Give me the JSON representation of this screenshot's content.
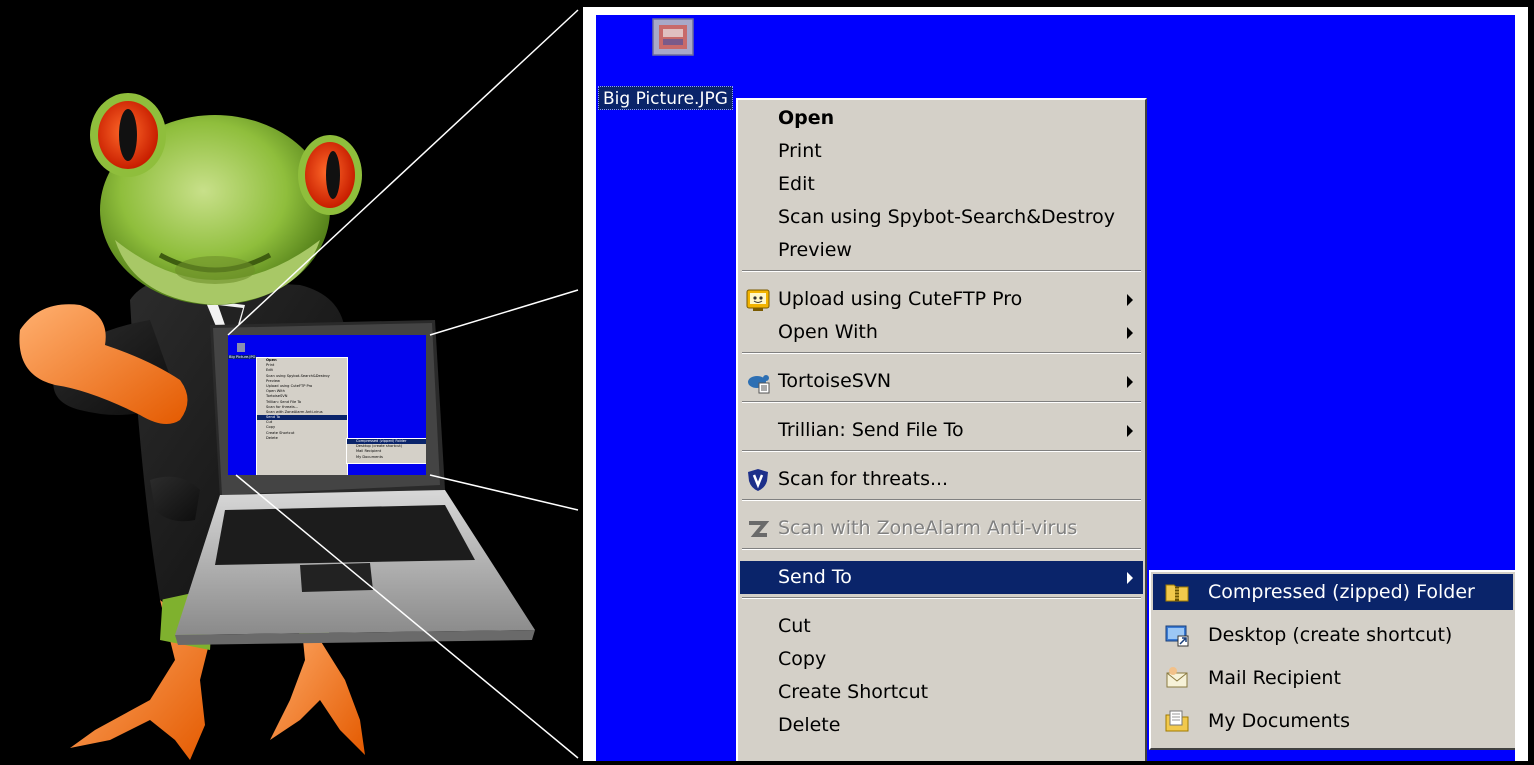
{
  "desktop": {
    "file_label": "Big Picture.JPG",
    "background_color": "#0000fe",
    "file_icon": "jpg-picture-icon"
  },
  "context_menu": {
    "items": [
      {
        "label": "Open",
        "bold": true
      },
      {
        "label": "Print"
      },
      {
        "label": "Edit"
      },
      {
        "label": "Scan using Spybot-Search&Destroy"
      },
      {
        "label": "Preview"
      },
      {
        "label": "Upload using CuteFTP Pro",
        "icon": "cuteftp-icon",
        "submenu": true
      },
      {
        "label": "Open With",
        "submenu": true
      },
      {
        "label": "TortoiseSVN",
        "icon": "tortoisesvn-icon",
        "submenu": true
      },
      {
        "label": "Trillian: Send File To",
        "submenu": true
      },
      {
        "label": "Scan for threats...",
        "icon": "shield-icon"
      },
      {
        "label": "Scan with ZoneAlarm Anti-virus",
        "icon": "zonealarm-icon",
        "disabled": true
      },
      {
        "label": "Send To",
        "highlighted": true,
        "submenu": true
      },
      {
        "label": "Cut"
      },
      {
        "label": "Copy"
      },
      {
        "label": "Create Shortcut"
      },
      {
        "label": "Delete"
      }
    ]
  },
  "send_to_menu": {
    "items": [
      {
        "label": "Compressed (zipped) Folder",
        "icon": "zip-folder-icon",
        "highlighted": true
      },
      {
        "label": "Desktop (create shortcut)",
        "icon": "desktop-icon"
      },
      {
        "label": "Mail Recipient",
        "icon": "mail-icon"
      },
      {
        "label": "My Documents",
        "icon": "my-documents-icon"
      }
    ]
  },
  "colors": {
    "menu_bg": "#d4d0c8",
    "highlight": "#0a246a",
    "desktop_blue": "#0000fe"
  }
}
